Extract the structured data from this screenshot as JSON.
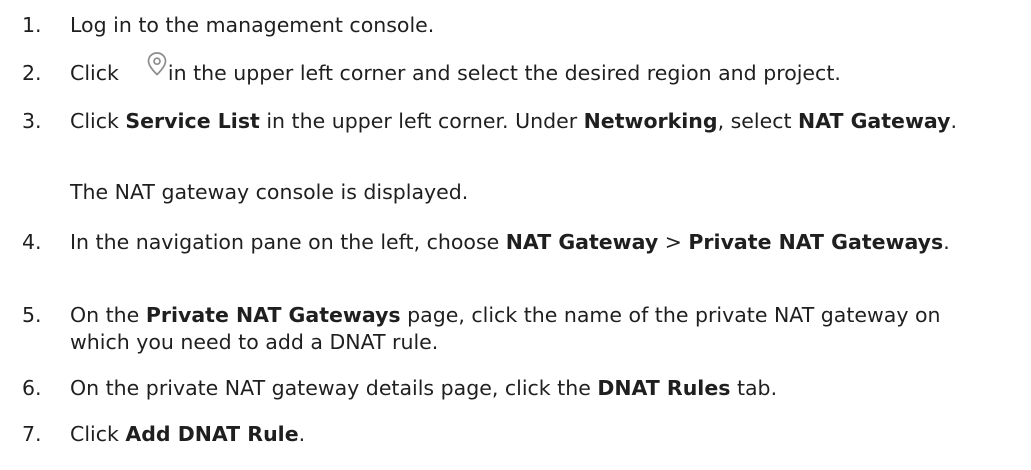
{
  "steps": [
    {
      "number": "1.",
      "segments": [
        {
          "text": "Log in to the management console.",
          "bold": false
        }
      ]
    },
    {
      "number": "2.",
      "segments": [
        {
          "text": "Click ",
          "bold": false
        },
        {
          "icon": "location-pin-icon"
        },
        {
          "text": " in the upper left corner and select the desired region and project.",
          "bold": false
        }
      ]
    },
    {
      "number": "3.",
      "segments": [
        {
          "text": "Click ",
          "bold": false
        },
        {
          "text": "Service List",
          "bold": true
        },
        {
          "text": " in the upper left corner. Under ",
          "bold": false
        },
        {
          "text": "Networking",
          "bold": true
        },
        {
          "text": ", select ",
          "bold": false
        },
        {
          "text": "NAT Gateway",
          "bold": true
        },
        {
          "text": ".",
          "bold": false
        }
      ]
    },
    {
      "number": "4.",
      "segments": [
        {
          "text": "In the navigation pane on the left, choose ",
          "bold": false
        },
        {
          "text": "NAT Gateway",
          "bold": true
        },
        {
          "text": " > ",
          "bold": false
        },
        {
          "text": "Private NAT Gateways",
          "bold": true
        },
        {
          "text": ".",
          "bold": false
        }
      ]
    },
    {
      "number": "5.",
      "segments": [
        {
          "text": "On the ",
          "bold": false
        },
        {
          "text": "Private NAT Gateways",
          "bold": true
        },
        {
          "text": " page, click the name of the private NAT gateway on which you need to add a DNAT rule.",
          "bold": false
        }
      ]
    },
    {
      "number": "6.",
      "segments": [
        {
          "text": "On the private NAT gateway details page, click the ",
          "bold": false
        },
        {
          "text": "DNAT Rules",
          "bold": true
        },
        {
          "text": " tab.",
          "bold": false
        }
      ]
    },
    {
      "number": "7.",
      "segments": [
        {
          "text": "Click ",
          "bold": false
        },
        {
          "text": "Add DNAT Rule",
          "bold": true
        },
        {
          "text": ".",
          "bold": false
        }
      ]
    }
  ],
  "step3_result": "The NAT gateway console is displayed.",
  "icon_color": "#8c8c8c"
}
